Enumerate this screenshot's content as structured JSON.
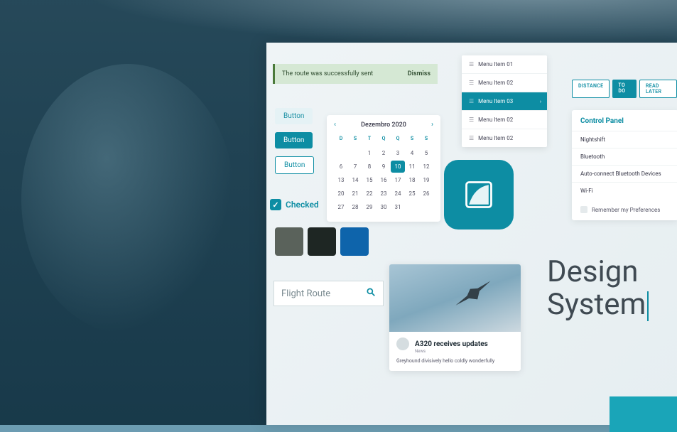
{
  "toast": {
    "message": "The route was successfully sent",
    "action": "Dismiss"
  },
  "buttons": {
    "light": "Button",
    "solid": "Button",
    "outline": "Button"
  },
  "checkbox": {
    "label": "Checked"
  },
  "swatches": [
    "#5a625b",
    "#1e2623",
    "#0e64ab"
  ],
  "search": {
    "placeholder": "Flight Route"
  },
  "calendar": {
    "title": "Dezembro 2020",
    "dow": [
      "D",
      "S",
      "T",
      "Q",
      "Q",
      "S",
      "S"
    ],
    "weeks": [
      [
        "",
        "",
        "1",
        "2",
        "3",
        "4",
        "5"
      ],
      [
        "6",
        "7",
        "8",
        "9",
        "10",
        "11",
        "12"
      ],
      [
        "13",
        "14",
        "15",
        "16",
        "17",
        "18",
        "19"
      ],
      [
        "20",
        "21",
        "22",
        "23",
        "24",
        "25",
        "26"
      ],
      [
        "27",
        "28",
        "29",
        "30",
        "31",
        "",
        ""
      ]
    ],
    "selected": "10"
  },
  "menu": {
    "items": [
      "Menu Item 01",
      "Menu Item 02",
      "Menu Item 03",
      "Menu Item 02",
      "Menu Item 02"
    ],
    "active_index": 2
  },
  "chips": [
    "DISTANCE",
    "TO DO",
    "READ LATER"
  ],
  "panel": {
    "title": "Control Panel",
    "items": [
      "Nightshift",
      "Bluetooth",
      "Auto-connect Bluetooth Devices",
      "Wi-Fi"
    ],
    "remember": "Remember my Preferences"
  },
  "heading": {
    "line1": "Design",
    "line2": "System"
  },
  "news": {
    "title": "A320 receives updates",
    "category": "News",
    "body": "Greyhound divisively hello coldly wonderfully"
  }
}
